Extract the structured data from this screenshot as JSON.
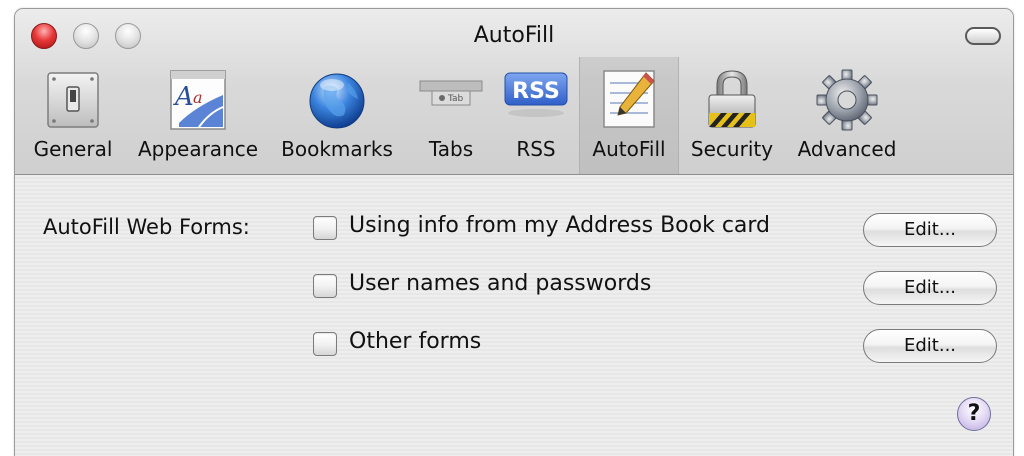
{
  "window": {
    "title": "AutoFill"
  },
  "toolbar": {
    "items": [
      {
        "label": "General",
        "icon": "switch-icon"
      },
      {
        "label": "Appearance",
        "icon": "appearance-icon"
      },
      {
        "label": "Bookmarks",
        "icon": "globe-icon"
      },
      {
        "label": "Tabs",
        "icon": "tabs-icon"
      },
      {
        "label": "RSS",
        "icon": "rss-icon"
      },
      {
        "label": "AutoFill",
        "icon": "autofill-pencil-icon",
        "selected": true
      },
      {
        "label": "Security",
        "icon": "padlock-icon"
      },
      {
        "label": "Advanced",
        "icon": "gear-icon"
      }
    ],
    "tabs_icon_text": "Tab",
    "rss_icon_text": "RSS"
  },
  "autofill": {
    "section_label": "AutoFill Web Forms:",
    "options": [
      {
        "label": "Using info from my Address Book card",
        "checked": false,
        "button": "Edit..."
      },
      {
        "label": "User names and passwords",
        "checked": false,
        "button": "Edit..."
      },
      {
        "label": "Other forms",
        "checked": false,
        "button": "Edit..."
      }
    ],
    "help_label": "?"
  },
  "colors": {
    "close": "#e8393a",
    "rss_badge": "#3d6fd6",
    "help": "#b9a6de",
    "chrome": "#d9d9d9",
    "content": "#ececec"
  }
}
